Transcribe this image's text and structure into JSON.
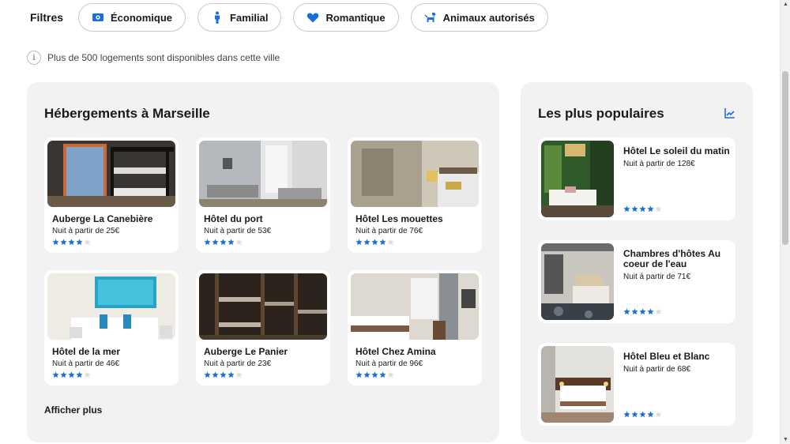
{
  "filters": {
    "label": "Filtres",
    "chips": [
      {
        "label": "Économique",
        "icon": "money-icon"
      },
      {
        "label": "Familial",
        "icon": "person-icon"
      },
      {
        "label": "Romantique",
        "icon": "heart-icon"
      },
      {
        "label": "Animaux autorisés",
        "icon": "dog-icon"
      }
    ]
  },
  "info": {
    "icon": "i",
    "text": "Plus de 500 logements sont disponibles dans cette ville"
  },
  "main": {
    "title": "Hébergements à Marseille",
    "show_more": "Afficher plus",
    "hotels": [
      {
        "name": "Auberge La Canebière",
        "price": "Nuit à partir de 25€",
        "stars": 4
      },
      {
        "name": "Hôtel du port",
        "price": "Nuit à partir de 53€",
        "stars": 4
      },
      {
        "name": "Hôtel Les mouettes",
        "price": "Nuit à partir de 76€",
        "stars": 4
      },
      {
        "name": "Hôtel de la mer",
        "price": "Nuit à partir de 46€",
        "stars": 4
      },
      {
        "name": "Auberge Le Panier",
        "price": "Nuit à partir de 23€",
        "stars": 4
      },
      {
        "name": "Hôtel Chez Amina",
        "price": "Nuit à partir de 96€",
        "stars": 4
      }
    ]
  },
  "popular": {
    "title": "Les plus populaires",
    "items": [
      {
        "name": "Hôtel Le soleil du matin",
        "price": "Nuit à partir de 128€",
        "stars": 4
      },
      {
        "name": "Chambres d'hôtes Au coeur de l'eau",
        "price": "Nuit à partir de 71€",
        "stars": 4
      },
      {
        "name": "Hôtel Bleu et Blanc",
        "price": "Nuit à partir de 68€",
        "stars": 4
      }
    ]
  },
  "colors": {
    "accent": "#1a6fe0",
    "star_empty": "#dcdcdc",
    "panel": "#f2f2f2"
  }
}
